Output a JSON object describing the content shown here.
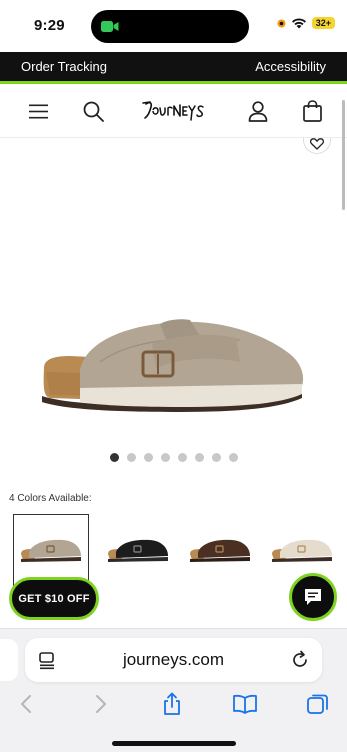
{
  "status_bar": {
    "time": "9:29",
    "battery": "32+"
  },
  "utility_bar": {
    "order_tracking": "Order Tracking",
    "accessibility": "Accessibility"
  },
  "header": {
    "logo": "Journeys",
    "icons": [
      "menu-icon",
      "search-icon",
      "account-icon",
      "cart-icon"
    ]
  },
  "product": {
    "image_count": 8,
    "active_image": 1
  },
  "colors": {
    "label": "4 Colors Available:",
    "swatches": [
      "taupe",
      "black",
      "brown",
      "cream"
    ]
  },
  "promo": {
    "label": "GET $10 OFF"
  },
  "safari": {
    "url": "journeys.com"
  },
  "theme": {
    "accent": "#7ed321",
    "dark": "#111111"
  }
}
